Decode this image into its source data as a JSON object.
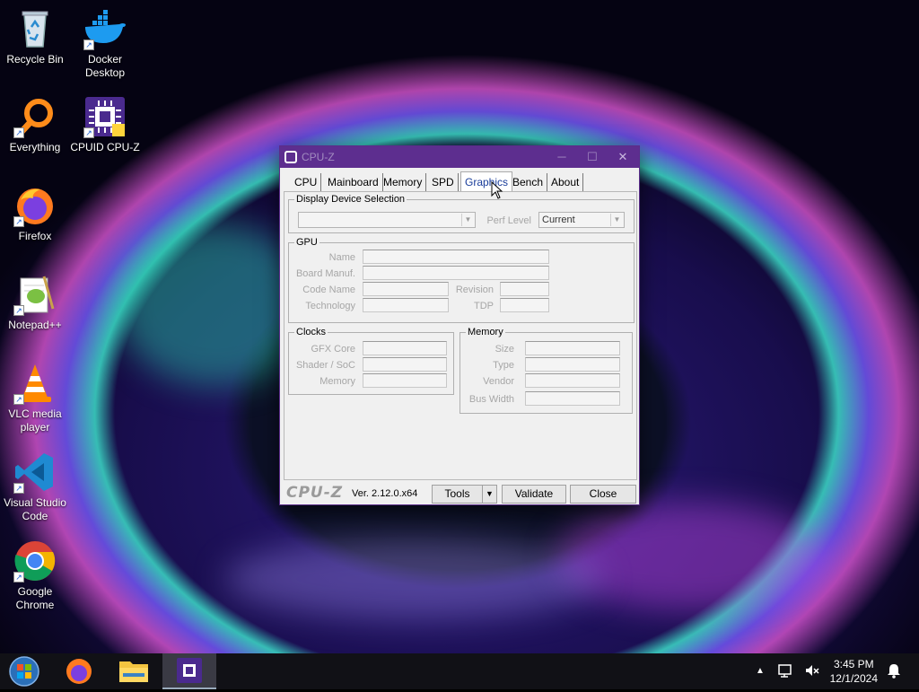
{
  "desktop": {
    "icons": [
      {
        "label": "Recycle Bin"
      },
      {
        "label": "Docker Desktop"
      },
      {
        "label": "Everything"
      },
      {
        "label": "CPUID CPU-Z"
      },
      {
        "label": "Firefox"
      },
      {
        "label": "Notepad++"
      },
      {
        "label": "VLC media player"
      },
      {
        "label": "Visual Studio Code"
      },
      {
        "label": "Google Chrome"
      }
    ]
  },
  "window": {
    "title": "CPU-Z",
    "tabs": [
      "CPU",
      "Mainboard",
      "Memory",
      "SPD",
      "Graphics",
      "Bench",
      "About"
    ],
    "active_tab": "Graphics",
    "display_device": {
      "legend": "Display Device Selection",
      "device_value": "",
      "perf_level_label": "Perf Level",
      "perf_level_value": "Current"
    },
    "gpu": {
      "legend": "GPU",
      "name_label": "Name",
      "board_manuf_label": "Board Manuf.",
      "code_name_label": "Code Name",
      "revision_label": "Revision",
      "technology_label": "Technology",
      "tdp_label": "TDP"
    },
    "clocks": {
      "legend": "Clocks",
      "gfx_core_label": "GFX Core",
      "shader_soc_label": "Shader / SoC",
      "memory_label": "Memory"
    },
    "memory": {
      "legend": "Memory",
      "size_label": "Size",
      "type_label": "Type",
      "vendor_label": "Vendor",
      "bus_width_label": "Bus Width"
    },
    "footer": {
      "logo": "CPU-Z",
      "version": "Ver. 2.12.0.x64",
      "tools_label": "Tools",
      "validate_label": "Validate",
      "close_label": "Close"
    }
  },
  "taskbar": {
    "time": "3:45 PM",
    "date": "12/1/2024"
  }
}
